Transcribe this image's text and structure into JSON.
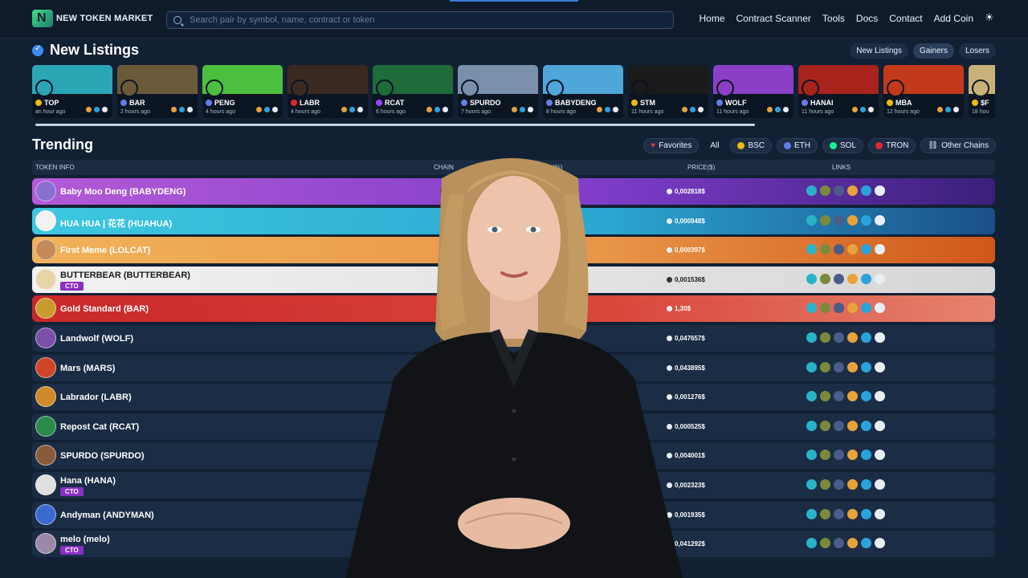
{
  "brand": {
    "name": "NEW TOKEN MARKET"
  },
  "search": {
    "placeholder": "Search pair by symbol, name, contract or token"
  },
  "nav": {
    "items": [
      "Home",
      "Contract Scanner",
      "Tools",
      "Docs",
      "Contact",
      "Add Coin"
    ]
  },
  "listings": {
    "title": "New Listings",
    "tabs": [
      "New Listings",
      "Gainers",
      "Losers"
    ],
    "cards": [
      {
        "symbol": "TOP",
        "time": "an hour ago",
        "color": "#2aa6b5",
        "chain": "#f0b90b"
      },
      {
        "symbol": "BAR",
        "time": "2 hours ago",
        "color": "#6b5a3a",
        "chain": "#627eea"
      },
      {
        "symbol": "PENG",
        "time": "4 hours ago",
        "color": "#4cbf3f",
        "chain": "#627eea"
      },
      {
        "symbol": "LABR",
        "time": "4 hours ago",
        "color": "#3a2a22",
        "chain": "#e0282e"
      },
      {
        "symbol": "RCAT",
        "time": "6 hours ago",
        "color": "#1f6b3a",
        "chain": "#9945ff"
      },
      {
        "symbol": "SPURDO",
        "time": "7 hours ago",
        "color": "#7a8faa",
        "chain": "#627eea"
      },
      {
        "symbol": "BABYDENG",
        "time": "8 hours ago",
        "color": "#4fa6d8",
        "chain": "#627eea"
      },
      {
        "symbol": "STM",
        "time": "11 hours ago",
        "color": "#1b1b1b",
        "chain": "#f0b90b"
      },
      {
        "symbol": "WOLF",
        "time": "11 hours ago",
        "color": "#8a3fc6",
        "chain": "#627eea"
      },
      {
        "symbol": "HANAI",
        "time": "11 hours ago",
        "color": "#a8231c",
        "chain": "#627eea"
      },
      {
        "symbol": "MBA",
        "time": "12 hours ago",
        "color": "#c23a1a",
        "chain": "#f0b90b"
      },
      {
        "symbol": "$F",
        "time": "18 hou",
        "color": "#c9b27a",
        "chain": "#f0b90b"
      }
    ]
  },
  "trending": {
    "title": "Trending",
    "filters": [
      "Favorites",
      "All",
      "BSC",
      "ETH",
      "SOL",
      "TRON",
      "Other Chains"
    ],
    "columns": {
      "token": "TOKEN INFO",
      "chain": "CHAIN",
      "change": "(%)",
      "price": "PRICE($)",
      "links": "LINKS"
    },
    "rows": [
      {
        "name": "Baby Moo Deng (BABYDENG)",
        "price": "0,002818$",
        "bg": "linear-gradient(90deg,#b45ad8,#7d3cc8 60%,#3a1f7a)",
        "ava": "#8a6fd0",
        "cto": false,
        "dark": false
      },
      {
        "name": "HUA HUA | 花花 (HUAHUA)",
        "price": "0,000948$",
        "bg": "linear-gradient(90deg,#3ec8e0,#2ba6d0 60%,#1a4f8a)",
        "ava": "#f2f2f2",
        "cto": false,
        "dark": false
      },
      {
        "name": "First Meme (LOLCAT)",
        "price": "0,000397$",
        "bg": "linear-gradient(90deg,#f1b25a,#e89548 60%,#d0571a)",
        "ava": "#c48a5a",
        "cto": false,
        "dark": false
      },
      {
        "name": "BUTTERBEAR (BUTTERBEAR)",
        "price": "0,001536$",
        "bg": "linear-gradient(90deg,#f2f2f2,#e2e2e2 60%,#d6d6d6)",
        "ava": "#e8d2a8",
        "cto": true,
        "dark": true
      },
      {
        "name": "Gold Standard (BAR)",
        "price": "1,30$",
        "bg": "linear-gradient(90deg,#c8282a,#d9463a 60%,#e6836e)",
        "ava": "#c99a2e",
        "cto": false,
        "dark": false
      },
      {
        "name": "Landwolf (WOLF)",
        "price": "0,047657$",
        "bg": "#1b2d45",
        "ava": "#7a4fa8",
        "cto": false,
        "dark": false
      },
      {
        "name": "Mars (MARS)",
        "price": "0,043895$",
        "bg": "#1b2d45",
        "ava": "#d0442a",
        "cto": false,
        "dark": false
      },
      {
        "name": "Labrador (LABR)",
        "price": "0,001276$",
        "bg": "#1b2d45",
        "ava": "#d08a2a",
        "cto": false,
        "dark": false
      },
      {
        "name": "Repost Cat (RCAT)",
        "price": "0,000525$",
        "bg": "#1b2d45",
        "ava": "#2a8a4a",
        "cto": false,
        "dark": false
      },
      {
        "name": "SPURDO (SPURDO)",
        "price": "0,004001$",
        "bg": "#1b2d45",
        "ava": "#8a5a3a",
        "cto": false,
        "dark": false
      },
      {
        "name": "Hana (HANA)",
        "price": "0,002323$",
        "bg": "#1b2d45",
        "ava": "#e0e0e0",
        "cto": true,
        "dark": false
      },
      {
        "name": "Andyman (ANDYMAN)",
        "price": "0,001935$",
        "bg": "#1b2d45",
        "ava": "#3a6ad0",
        "cto": false,
        "dark": false
      },
      {
        "name": "melo (melo)",
        "price": "0,041292$",
        "bg": "#1b2d45",
        "ava": "#9a8aa8",
        "cto": true,
        "dark": false
      }
    ]
  },
  "labels": {
    "cto": "CTO"
  },
  "colors": {
    "accent": "#3a8df0",
    "cto": "#8a2fc6",
    "background": "#122033"
  }
}
